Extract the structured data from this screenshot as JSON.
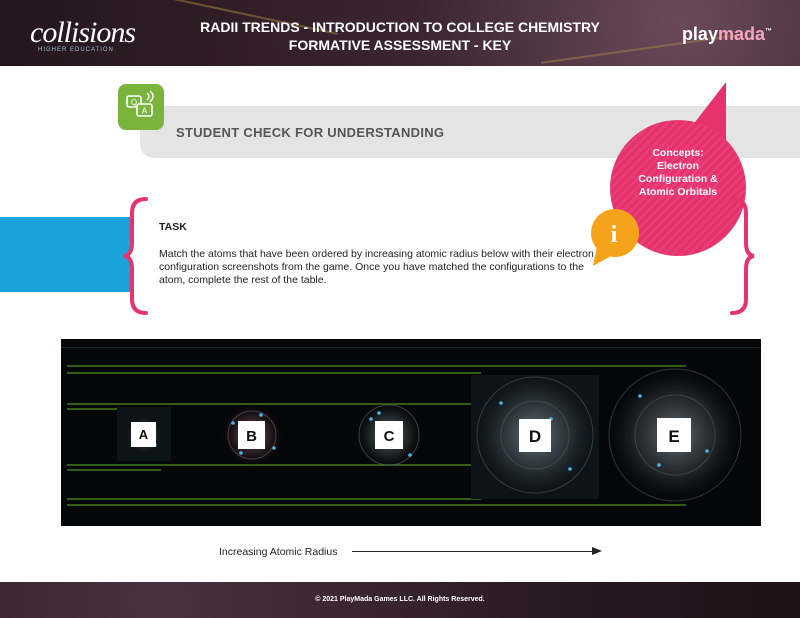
{
  "header": {
    "logo_text": "collisions",
    "logo_sub": "HIGHER EDUCATION",
    "title_line1": "RADII TRENDS - INTRODUCTION TO COLLEGE CHEMISTRY",
    "title_line2": "FORMATIVE ASSESSMENT - KEY",
    "brand_main": "play",
    "brand_accent": "mada",
    "brand_tm": "™"
  },
  "check": {
    "label": "STUDENT CHECK FOR UNDERSTANDING",
    "icon": "speech-bubbles-icon",
    "icon_color": "#7ab43c"
  },
  "concepts": {
    "line1": "Concepts:",
    "line2": "Electron",
    "line3": "Configuration &",
    "line4": "Atomic Orbitals",
    "color": "#e6336e"
  },
  "task": {
    "label": "TASK",
    "body": "Match the atoms that have been ordered by increasing atomic radius below with their electron configuration screenshots from the game. Once you have matched the configurations to the atom, complete the rest of the table.",
    "info_icon": "info-icon",
    "info_color": "#f5a31a",
    "accent_blue": "#1aa3d9"
  },
  "atoms": [
    {
      "label": "A"
    },
    {
      "label": "B"
    },
    {
      "label": "C"
    },
    {
      "label": "D"
    },
    {
      "label": "E"
    }
  ],
  "axis": {
    "label": "Increasing Atomic Radius"
  },
  "footer": {
    "copyright": "© 2021 PlayMada Games LLC. All Rights Reserved."
  }
}
